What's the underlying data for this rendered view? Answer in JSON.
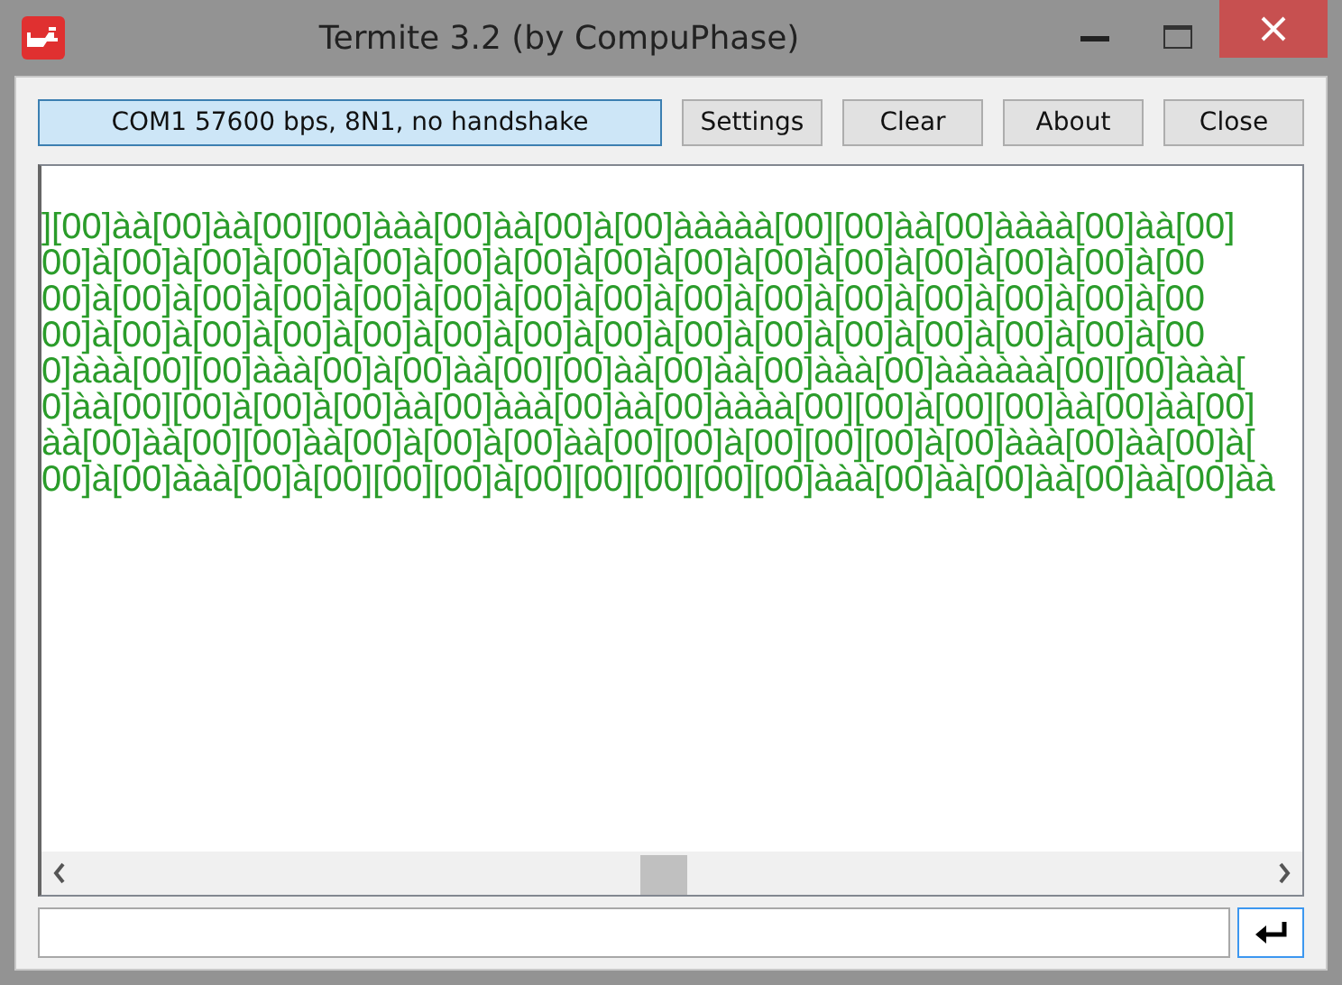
{
  "window": {
    "title": "Termite 3.2 (by CompuPhase)"
  },
  "toolbar": {
    "connection": "COM1 57600 bps, 8N1, no handshake",
    "buttons": [
      "Settings",
      "Clear",
      "About",
      "Close"
    ]
  },
  "terminal": {
    "lines": [
      "][00]àà[00]àà[00][00]ààà[00]àà[00]à[00]ààààà[00][00]àà[00]àààà[00]àà[00]",
      "00]à[00]à[00]à[00]à[00]à[00]à[00]à[00]à[00]à[00]à[00]à[00]à[00]à[00]à[00",
      "00]à[00]à[00]à[00]à[00]à[00]à[00]à[00]à[00]à[00]à[00]à[00]à[00]à[00]à[00",
      "00]à[00]à[00]à[00]à[00]à[00]à[00]à[00]à[00]à[00]à[00]à[00]à[00]à[00]à[00",
      "0]ààà[00][00]ààà[00]à[00]àà[00][00]àà[00]àà[00]ààà[00]àààààà[00][00]ààà[",
      "0]àà[00][00]à[00]à[00]àà[00]ààà[00]àà[00]àààà[00][00]à[00][00]àà[00]àà[00]",
      "àà[00]àà[00][00]àà[00]à[00]à[00]àà[00][00]à[00][00][00]à[00]ààà[00]àà[00]à[",
      "00]à[00]ààà[00]à[00][00][00]à[00][00][00][00][00]ààà[00]àà[00]àà[00]àà[00]àà"
    ]
  }
}
